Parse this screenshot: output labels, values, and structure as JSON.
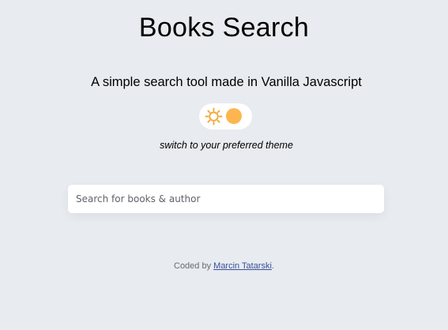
{
  "header": {
    "title": "Books Search",
    "subtitle": "A simple search tool made in Vanilla Javascript"
  },
  "theme": {
    "toggle_icon": "sun-icon",
    "hint": "switch to your preferred theme",
    "sun_color": "#f2a93b",
    "knob_color": "#fdb64f"
  },
  "search": {
    "value": "",
    "placeholder": "Search for books & author"
  },
  "footer": {
    "prefix": "Coded by ",
    "author_link": "Marcin Tatarski",
    "suffix": "."
  }
}
